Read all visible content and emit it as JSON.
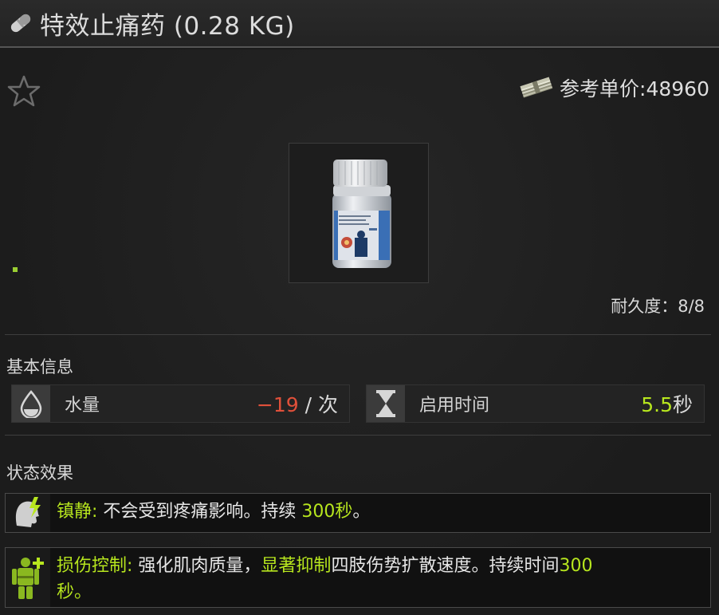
{
  "header": {
    "title": "特效止痛药 (0.28 KG)",
    "icon": "pill-icon"
  },
  "item": {
    "price_label": "参考单价:48960",
    "durability": "耐久度：8/8",
    "image": "pill-bottle"
  },
  "basic_info": {
    "title": "基本信息",
    "hydration": {
      "label": "水量",
      "value": "−19",
      "unit": " / 次",
      "icon": "water-drop-icon"
    },
    "use_time": {
      "label": "启用时间",
      "value": "5.5",
      "unit": "秒",
      "icon": "hourglass-icon"
    }
  },
  "status_effects": {
    "title": "状态效果",
    "effects": [
      {
        "name": "镇静:",
        "icon": "sedation-icon",
        "text_pre": " 不会受到疼痛影响。持续 ",
        "highlight1": "300秒",
        "text_post": "。"
      },
      {
        "name": "损伤控制:",
        "icon": "damage-control-icon",
        "text_pre": " 强化肌肉质量，",
        "highlight1": "显著抑制",
        "text_mid": "四肢伤势扩散速度。持续时间",
        "highlight2": "300",
        "line2": "秒。"
      }
    ]
  },
  "colors": {
    "accent_green": "#b7e61e",
    "negative_red": "#e0503a",
    "background": "#1b1b1b"
  }
}
